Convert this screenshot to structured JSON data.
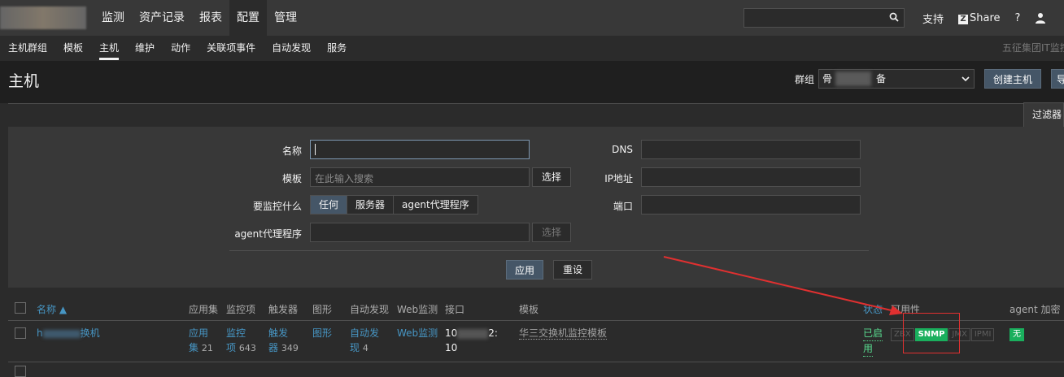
{
  "topnav": {
    "items": [
      "监测",
      "资产记录",
      "报表",
      "配置",
      "管理"
    ],
    "active_index": 3,
    "search_placeholder": "",
    "links": {
      "support": "支持",
      "share": "Share",
      "help": "?"
    }
  },
  "subnav": {
    "items": [
      "主机群组",
      "模板",
      "主机",
      "维护",
      "动作",
      "关联项事件",
      "自动发现",
      "服务"
    ],
    "active_index": 2,
    "right_text": "五征集团IT监控"
  },
  "header": {
    "title": "主机",
    "group_label": "群组",
    "group_value_prefix": "骨",
    "group_value_suffix": "备",
    "create_button": "创建主机",
    "import_button": "导"
  },
  "filter": {
    "tab_label": "过滤器",
    "name_label": "名称",
    "name_value": "",
    "template_label": "模板",
    "template_placeholder": "在此输入搜索",
    "select_button": "选择",
    "monitor_label": "要监控什么",
    "monitor_options": [
      "任何",
      "服务器",
      "agent代理程序"
    ],
    "monitor_selected": 0,
    "agent_label": "agent代理程序",
    "agent_select_button": "选择",
    "dns_label": "DNS",
    "ip_label": "IP地址",
    "port_label": "端口",
    "apply_button": "应用",
    "reset_button": "重设"
  },
  "table": {
    "headers": {
      "name": "名称 ▲",
      "apps": "应用集",
      "items": "监控项",
      "triggers": "触发器",
      "graphs": "图形",
      "discovery": "自动发现",
      "web": "Web监测",
      "interface": "接口",
      "templates": "模板",
      "status": "状态",
      "availability": "可用性",
      "agent_enc": "agent 加密"
    },
    "rows": [
      {
        "name_start": "h",
        "name_end": "换机",
        "apps_line1": "应用",
        "apps_line2": "集",
        "apps_count": "21",
        "items_line1": "监控",
        "items_line2": "项",
        "items_count": "643",
        "triggers_line1": "触发",
        "triggers_line2": "器",
        "triggers_count": "349",
        "graphs": "图形",
        "discovery_line1": "自动发",
        "discovery_line2": "现",
        "discovery_count": "4",
        "web": "Web监测",
        "iface_line1_start": "10",
        "iface_line1_end": "2:",
        "iface_line2_start": "10",
        "template": "华三交换机监控模板",
        "status_line1": "已启",
        "status_line2": "用",
        "avail": [
          "ZBX",
          "SNMP",
          "JMX",
          "IPMI"
        ],
        "avail_active": "SNMP",
        "encryption": "无"
      }
    ]
  },
  "colors": {
    "accent": "#4796c4",
    "enabled_green": "#59db8f",
    "badge_green": "#1aaf5d",
    "annotation_red": "#e03030"
  }
}
